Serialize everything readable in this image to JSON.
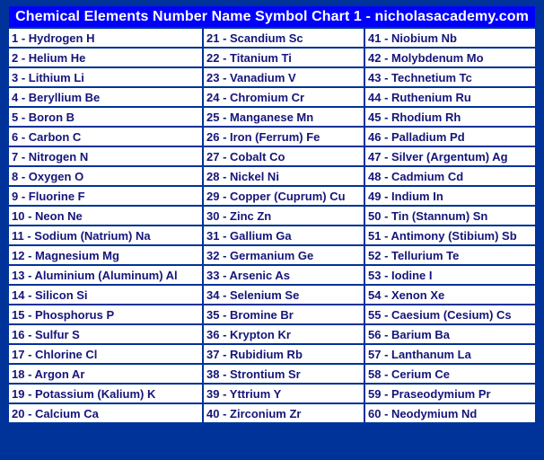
{
  "title": "Chemical Elements Number Name Symbol Chart 1 - nicholasacademy.com",
  "colors": {
    "background": "#003399",
    "title_bar": "#0000ff",
    "title_text": "#ffffff",
    "cell_bg": "#ffffff",
    "cell_text": "#15157a"
  },
  "rows": [
    [
      "1 - Hydrogen H",
      "21 - Scandium Sc",
      "41 - Niobium Nb"
    ],
    [
      "2 - Helium He",
      "22 - Titanium Ti",
      "42 - Molybdenum Mo"
    ],
    [
      "3 - Lithium Li",
      "23 - Vanadium V",
      "43 - Technetium Tc"
    ],
    [
      "4 - Beryllium Be",
      "24 - Chromium Cr",
      "44 - Ruthenium Ru"
    ],
    [
      "5 - Boron B",
      "25 - Manganese Mn",
      "45 - Rhodium Rh"
    ],
    [
      "6 - Carbon C",
      "26 - Iron (Ferrum) Fe",
      "46 - Palladium Pd"
    ],
    [
      "7 - Nitrogen N",
      "27 - Cobalt Co",
      "47 - Silver (Argentum) Ag"
    ],
    [
      "8 - Oxygen O",
      "28 - Nickel Ni",
      "48 - Cadmium Cd"
    ],
    [
      "9 - Fluorine F",
      "29 - Copper (Cuprum) Cu",
      "49 - Indium In"
    ],
    [
      "10 - Neon Ne",
      "30 - Zinc Zn",
      "50 - Tin (Stannum) Sn"
    ],
    [
      "11 - Sodium (Natrium) Na",
      "31 - Gallium Ga",
      "51 - Antimony (Stibium) Sb"
    ],
    [
      "12 - Magnesium Mg",
      "32 - Germanium Ge",
      "52 - Tellurium Te"
    ],
    [
      "13 - Aluminium (Aluminum) Al",
      "33 - Arsenic As",
      "53 - Iodine I"
    ],
    [
      "14 - Silicon Si",
      "34 - Selenium Se",
      "54 - Xenon Xe"
    ],
    [
      "15 - Phosphorus P",
      "35 - Bromine Br",
      "55 - Caesium (Cesium) Cs"
    ],
    [
      "16 - Sulfur S",
      "36 - Krypton Kr",
      "56 - Barium Ba"
    ],
    [
      "17 - Chlorine Cl",
      "37 - Rubidium Rb",
      "57 - Lanthanum La"
    ],
    [
      "18 - Argon Ar",
      "38 - Strontium Sr",
      "58 - Cerium Ce"
    ],
    [
      "19 - Potassium (Kalium) K",
      "39 - Yttrium Y",
      "59 - Praseodymium Pr"
    ],
    [
      "20 - Calcium Ca",
      "40 - Zirconium Zr",
      "60 - Neodymium Nd"
    ]
  ]
}
